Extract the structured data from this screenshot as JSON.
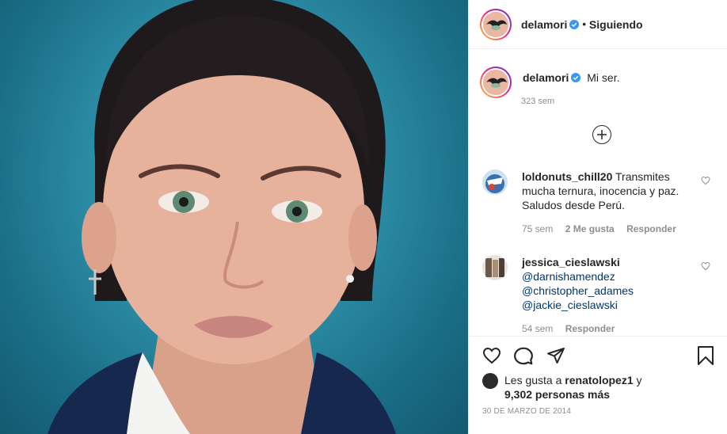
{
  "post": {
    "username": "delamori",
    "following_label": "Siguiendo",
    "caption": "Mi ser.",
    "caption_age": "323 sem"
  },
  "comments": [
    {
      "username": "loldonuts_chill20",
      "text": "Transmites mucha ternura, inocencia y paz. Saludos desde Perú.",
      "age": "75 sem",
      "likes": "2 Me gusta",
      "reply": "Responder"
    },
    {
      "username": "jessica_cieslawski",
      "mentions": [
        "@darnishamendez",
        "@christopher_adames",
        "@jackie_cieslawski"
      ],
      "age": "54 sem",
      "reply": "Responder"
    }
  ],
  "likes": {
    "prefix": "Les gusta a",
    "user": "renatolopez1",
    "connector": "y",
    "others": "9,302 personas más"
  },
  "date": "30 DE MARZO DE 2014",
  "icons": {
    "verified": "verified-badge-icon",
    "load_more": "plus-circle-icon",
    "like": "heart-icon",
    "comment": "comment-bubble-icon",
    "share": "paper-plane-icon",
    "save": "bookmark-icon"
  },
  "colors": {
    "verified": "#3897f0",
    "text": "#262626",
    "muted": "#8e8e8e",
    "mention": "#00376b"
  }
}
